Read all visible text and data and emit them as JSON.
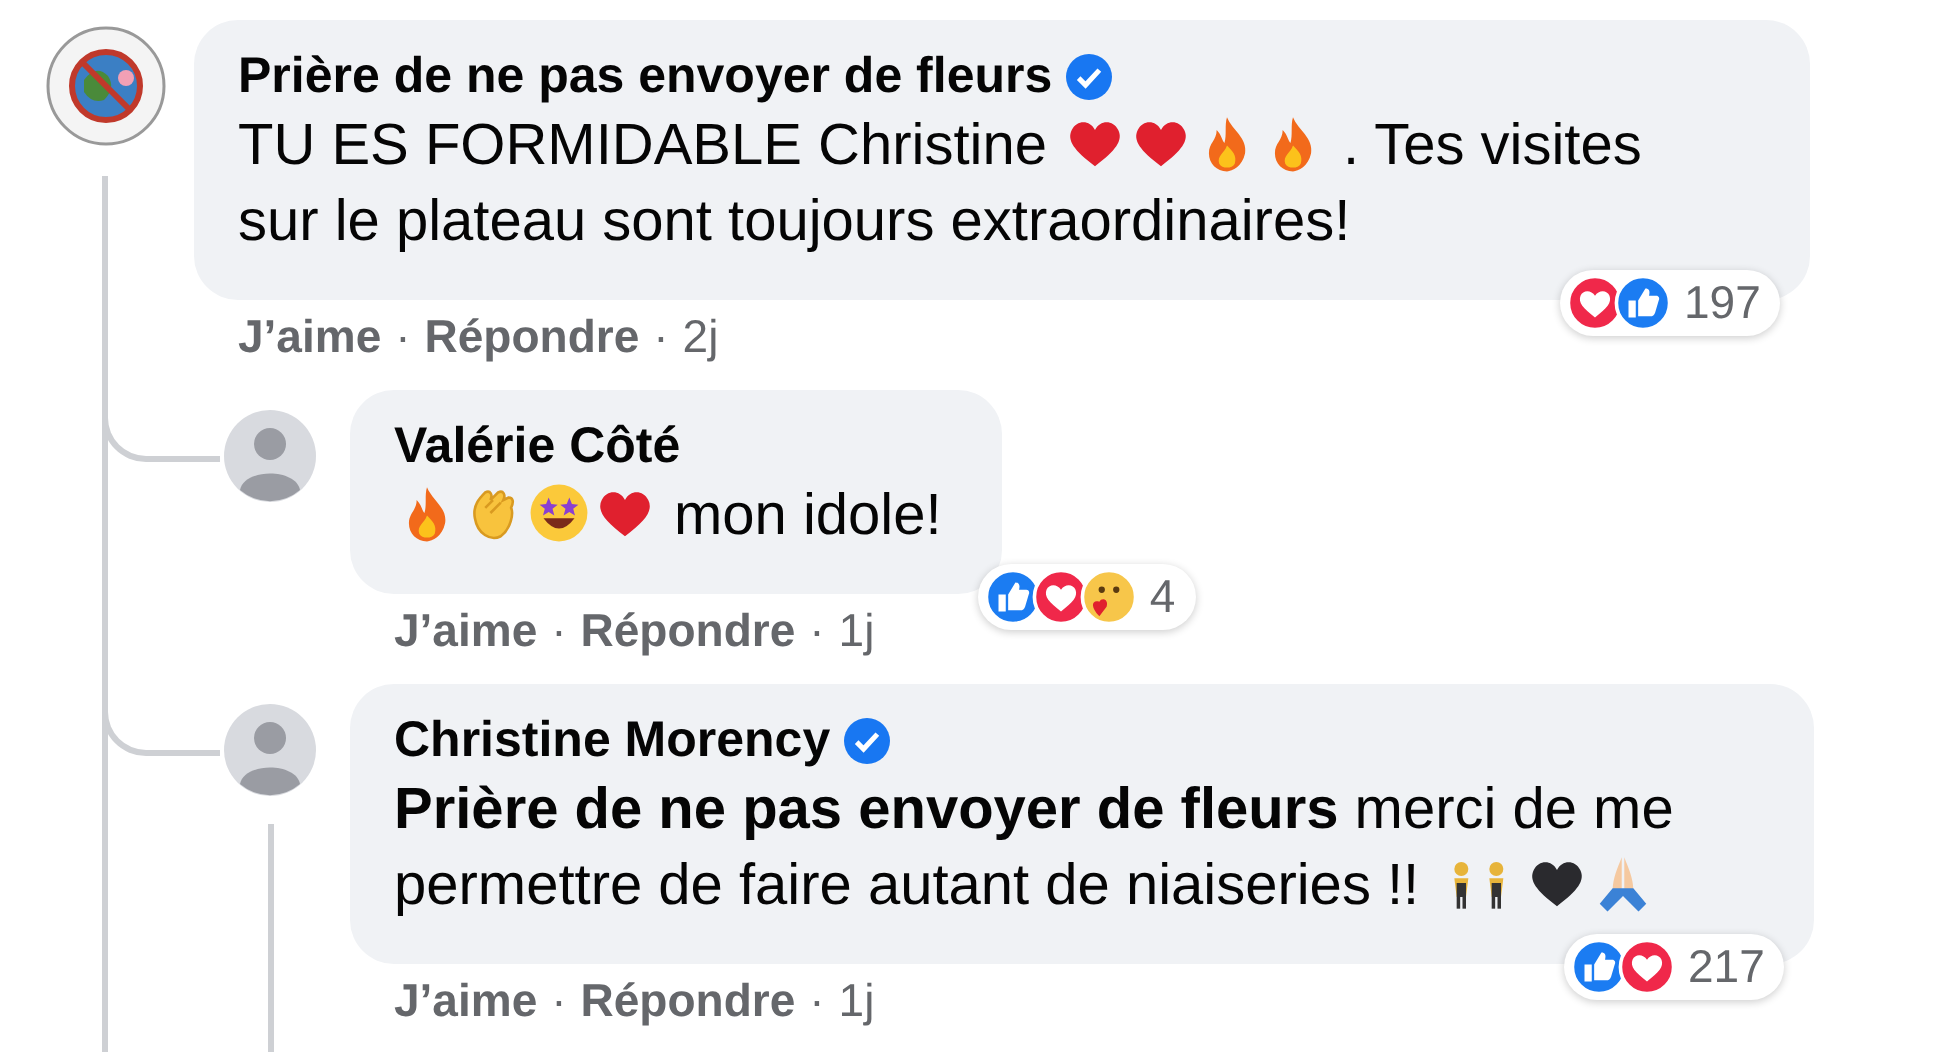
{
  "comments": [
    {
      "author": "Prière de ne pas envoyer de fleurs",
      "verified": true,
      "avatar": {
        "kind": "logo"
      },
      "body": [
        {
          "kind": "text",
          "text": "TU ES FORMIDABLE Christine"
        },
        {
          "kind": "heart"
        },
        {
          "kind": "heart"
        },
        {
          "kind": "fire"
        },
        {
          "kind": "fire"
        },
        {
          "kind": "text",
          "text": ". Tes visites"
        },
        {
          "kind": "text",
          "text": "sur le plateau sont toujours extraordinaires!"
        }
      ],
      "actions": [
        {
          "kind": "link",
          "text": "J’aime"
        },
        {
          "kind": "separator",
          "text": "·"
        },
        {
          "kind": "link",
          "text": "Répondre"
        },
        {
          "kind": "separator",
          "text": "·"
        },
        {
          "kind": "time",
          "text": "2j"
        }
      ],
      "reactions": {
        "types": [
          {
            "kind": "love"
          },
          {
            "kind": "like"
          }
        ],
        "count": "197"
      },
      "replies": [
        {
          "author": "Valérie Côté",
          "verified": false,
          "avatar": {
            "kind": "photo"
          },
          "body": [
            {
              "kind": "fire"
            },
            {
              "kind": "clap"
            },
            {
              "kind": "starstruck"
            },
            {
              "kind": "heart"
            },
            {
              "kind": "text",
              "text": "mon idole!"
            }
          ],
          "actions": [
            {
              "kind": "link",
              "text": "J’aime"
            },
            {
              "kind": "separator",
              "text": "·"
            },
            {
              "kind": "link",
              "text": "Répondre"
            },
            {
              "kind": "separator",
              "text": "·"
            },
            {
              "kind": "time",
              "text": "1j"
            }
          ],
          "reactions": {
            "types": [
              {
                "kind": "like"
              },
              {
                "kind": "love"
              },
              {
                "kind": "care"
              }
            ],
            "count": "4"
          }
        },
        {
          "author": "Christine Morency",
          "verified": true,
          "avatar": {
            "kind": "photo"
          },
          "body": [
            {
              "kind": "mention",
              "text": "Prière de ne pas envoyer de fleurs"
            },
            {
              "kind": "text",
              "text": "merci de me"
            },
            {
              "kind": "text",
              "text": "permettre de faire autant de niaiseries !!"
            },
            {
              "kind": "dancers"
            },
            {
              "kind": "blackheart"
            },
            {
              "kind": "pray"
            }
          ],
          "actions": [
            {
              "kind": "link",
              "text": "J’aime"
            },
            {
              "kind": "separator",
              "text": "·"
            },
            {
              "kind": "link",
              "text": "Répondre"
            },
            {
              "kind": "separator",
              "text": "·"
            },
            {
              "kind": "time",
              "text": "1j"
            }
          ],
          "reactions": {
            "types": [
              {
                "kind": "like"
              },
              {
                "kind": "love"
              }
            ],
            "count": "217"
          }
        }
      ]
    }
  ]
}
